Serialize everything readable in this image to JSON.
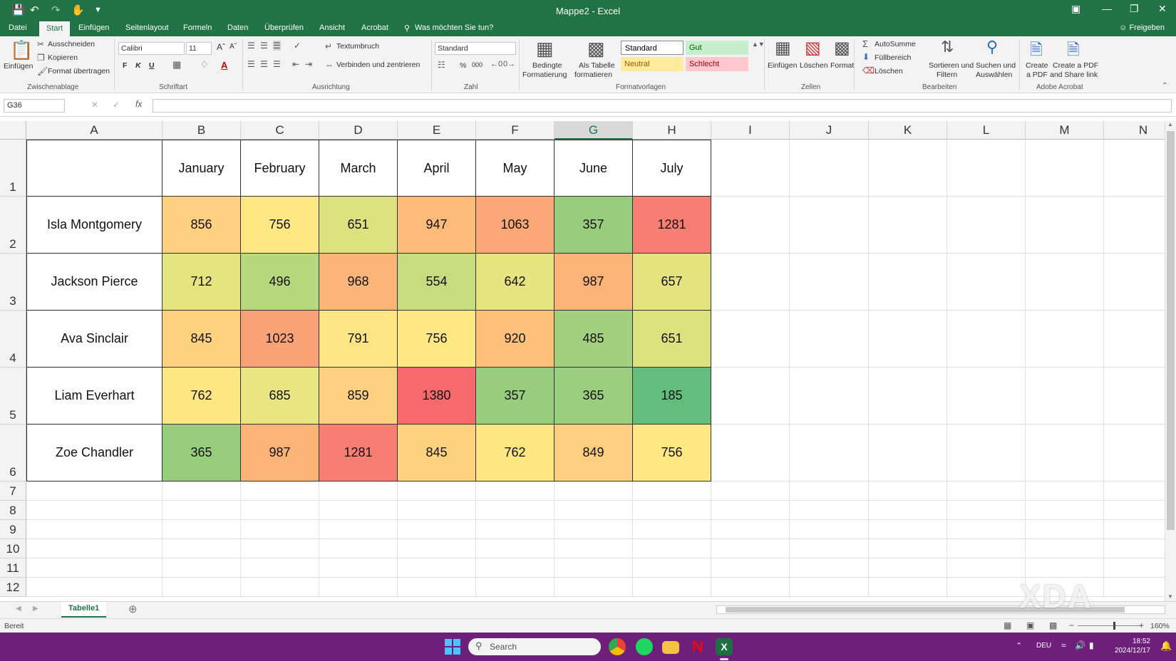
{
  "window": {
    "title": "Mappe2 - Excel"
  },
  "tabs": [
    "Datei",
    "Start",
    "Einfügen",
    "Seitenlayout",
    "Formeln",
    "Daten",
    "Überprüfen",
    "Ansicht",
    "Acrobat"
  ],
  "tell_me": "Was möchten Sie tun?",
  "share": "Freigeben",
  "ribbon": {
    "clipboard": {
      "paste": "Einfügen",
      "cut": "Ausschneiden",
      "copy": "Kopieren",
      "format_painter": "Format übertragen",
      "group": "Zwischenablage"
    },
    "font": {
      "name": "Calibri",
      "size": "11",
      "group": "Schriftart",
      "bold": "F",
      "italic": "K",
      "underline": "U",
      "font_color": "A"
    },
    "alignment": {
      "wrap": "Textumbruch",
      "merge": "Verbinden und zentrieren",
      "group": "Ausrichtung"
    },
    "number": {
      "format": "Standard",
      "percent": "%",
      "thousands": "000",
      "group": "Zahl"
    },
    "styles": {
      "conditional": "Bedingte",
      "conditional2": "Formatierung",
      "as_table": "Als Tabelle",
      "as_table2": "formatieren",
      "group": "Formatvorlagen",
      "standard": "Standard",
      "gut": "Gut",
      "neutral": "Neutral",
      "schlecht": "Schlecht"
    },
    "cells": {
      "insert": "Einfügen",
      "delete": "Löschen",
      "format": "Format",
      "group": "Zellen"
    },
    "editing": {
      "autosum": "AutoSumme",
      "fill": "Füllbereich",
      "clear": "Löschen",
      "sort": "Sortieren und",
      "sort2": "Filtern",
      "find": "Suchen und",
      "find2": "Auswählen",
      "group": "Bearbeiten"
    },
    "acrobat": {
      "create": "Create",
      "create2": "a PDF",
      "share": "Create a PDF",
      "share2": "and Share link",
      "group": "Adobe Acrobat"
    }
  },
  "formula_bar": {
    "name_box": "G36",
    "fx": "fx"
  },
  "columns": [
    "A",
    "B",
    "C",
    "D",
    "E",
    "F",
    "G",
    "H",
    "I",
    "J",
    "K",
    "L",
    "M",
    "N"
  ],
  "rows": [
    "1",
    "2",
    "3",
    "4",
    "5",
    "6",
    "7",
    "8",
    "9",
    "10",
    "11",
    "12"
  ],
  "table": {
    "header": [
      "",
      "January",
      "February",
      "March",
      "April",
      "May",
      "June",
      "July"
    ],
    "rows": [
      {
        "name": "Isla Montgomery",
        "values": [
          "856",
          "756",
          "651",
          "947",
          "1063",
          "357",
          "1281"
        ]
      },
      {
        "name": "Jackson Pierce",
        "values": [
          "712",
          "496",
          "968",
          "554",
          "642",
          "987",
          "657"
        ]
      },
      {
        "name": "Ava Sinclair",
        "values": [
          "845",
          "1023",
          "791",
          "756",
          "920",
          "485",
          "651"
        ]
      },
      {
        "name": "Liam Everhart",
        "values": [
          "762",
          "685",
          "859",
          "1380",
          "357",
          "365",
          "185"
        ]
      },
      {
        "name": "Zoe Chandler",
        "values": [
          "365",
          "987",
          "1281",
          "845",
          "762",
          "849",
          "756"
        ]
      }
    ],
    "fills": [
      [
        "#fdd17f",
        "#fee883",
        "#dde27f",
        "#fdbb7a",
        "#fba877",
        "#98cd7d",
        "#f87e71"
      ],
      [
        "#e4e480",
        "#b8d87e",
        "#fcb579",
        "#c6dc7f",
        "#e5e480",
        "#fcb378",
        "#e3e480"
      ],
      [
        "#fdd27f",
        "#fba276",
        "#fee583",
        "#fee883",
        "#fdc17b",
        "#a1d07e",
        "#dde27f"
      ],
      [
        "#fee683",
        "#e8e582",
        "#fdd17f",
        "#f76a6c",
        "#98cd7d",
        "#9bce7d",
        "#63be7b"
      ],
      [
        "#98cd7d",
        "#fcb378",
        "#f87e71",
        "#fdd27f",
        "#fee683",
        "#fdcf7f",
        "#fee883"
      ]
    ]
  },
  "sheet_tabs": [
    "Tabelle1"
  ],
  "status": {
    "ready": "Bereit",
    "zoom": "160%"
  },
  "taskbar": {
    "search": "Search",
    "lang": "DEU",
    "time": "18:52",
    "date": "2024/12/17"
  },
  "watermark": "XDA"
}
